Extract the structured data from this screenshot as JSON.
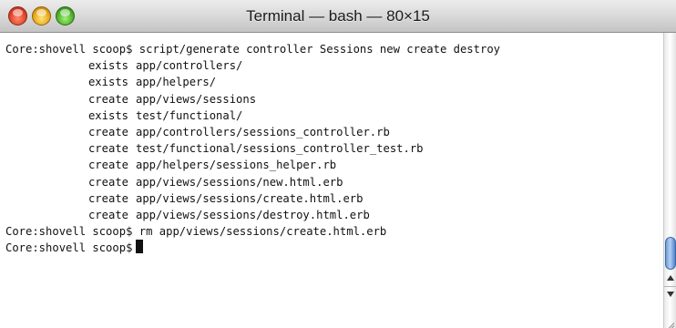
{
  "window": {
    "title": "Terminal — bash — 80×15"
  },
  "terminal": {
    "prompt": "Core:shovell scoop$",
    "command1": "script/generate controller Sessions new create destroy",
    "generator_output": [
      {
        "action": "exists",
        "path": "app/controllers/"
      },
      {
        "action": "exists",
        "path": "app/helpers/"
      },
      {
        "action": "create",
        "path": "app/views/sessions"
      },
      {
        "action": "exists",
        "path": "test/functional/"
      },
      {
        "action": "create",
        "path": "app/controllers/sessions_controller.rb"
      },
      {
        "action": "create",
        "path": "test/functional/sessions_controller_test.rb"
      },
      {
        "action": "create",
        "path": "app/helpers/sessions_helper.rb"
      },
      {
        "action": "create",
        "path": "app/views/sessions/new.html.erb"
      },
      {
        "action": "create",
        "path": "app/views/sessions/create.html.erb"
      },
      {
        "action": "create",
        "path": "app/views/sessions/destroy.html.erb"
      }
    ],
    "command2": "rm app/views/sessions/create.html.erb",
    "command3": ""
  },
  "icons": {
    "close": "close-icon",
    "minimize": "minimize-icon",
    "zoom": "zoom-icon",
    "cursor": "block-cursor-icon",
    "scroll_up": "arrow-up-icon",
    "scroll_down": "arrow-down-icon",
    "resize": "resize-grip-icon"
  },
  "colors": {
    "close": "#e0442b",
    "minimize": "#e8a91a",
    "zoom": "#4cb02a",
    "background": "#ffffff",
    "text": "#111111",
    "scroll_thumb": "#6d9bd8"
  }
}
